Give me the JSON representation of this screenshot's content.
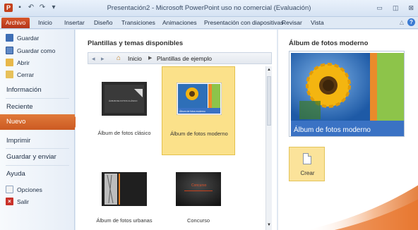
{
  "window": {
    "title": "Presentación2 - Microsoft PowerPoint uso no comercial (Evaluación)",
    "app_icon": "P"
  },
  "ribbon": {
    "tabs": [
      "Archivo",
      "Inicio",
      "Insertar",
      "Diseño",
      "Transiciones",
      "Animaciones",
      "Presentación con diapositivas",
      "Revisar",
      "Vista"
    ]
  },
  "backstage_nav": {
    "commands": [
      "Guardar",
      "Guardar como",
      "Abrir",
      "Cerrar"
    ],
    "items": [
      "Información",
      "Reciente",
      "Nuevo",
      "Imprimir",
      "Guardar y enviar",
      "Ayuda"
    ],
    "active": "Nuevo",
    "footer_commands": [
      "Opciones",
      "Salir"
    ]
  },
  "templates": {
    "heading": "Plantillas y temas disponibles",
    "breadcrumb": [
      "Inicio",
      "Plantillas de ejemplo"
    ],
    "tiles": [
      {
        "label": "Álbum de fotos clásico",
        "selected": false
      },
      {
        "label": "Álbum de fotos moderno",
        "selected": true
      },
      {
        "label": "Álbum de fotos urbanas",
        "selected": false
      },
      {
        "label": "Concurso",
        "selected": false
      }
    ],
    "thumb_texts": {
      "classic": "ÁLBUM DE FOTOS CLÁSICO",
      "modern": "Álbum de fotos moderno",
      "contest": "Concurso"
    }
  },
  "preview": {
    "title": "Álbum de fotos moderno",
    "caption": "Álbum de fotos moderno",
    "create_label": "Crear"
  },
  "colors": {
    "accent_orange": "#d76529",
    "selection_yellow": "#fbe18a",
    "modern_green": "#8dc44a",
    "modern_blue": "#3a72c4"
  }
}
